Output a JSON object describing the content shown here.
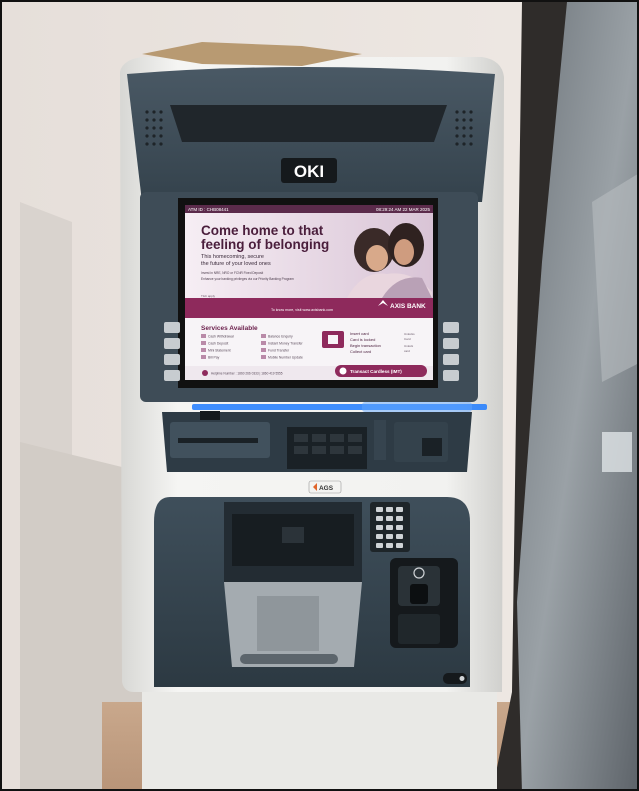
{
  "brand": {
    "label": "OKI"
  },
  "screen": {
    "status_left": "ATM ID : CHB08441",
    "status_right": "08:29:24 AM   22 MAR 2025",
    "headline_line1": "Come home to that",
    "headline_line2": "feeling of belonging",
    "subline1": "This homecoming, secure",
    "subline2": "the future of your loved ones",
    "bullet1": "Invest in NRE, NRO or FCNR Fixed Deposit",
    "bullet2": "Enhance your banking privileges via our Priority Banking Program",
    "bank_name": "AXIS BANK",
    "footer_link": "To know more, visit www.axisbank.com",
    "tc": "T&C apply",
    "services_title": "Services Available",
    "services": [
      "Cash Withdrawal",
      "Balance Enquiry",
      "Cash Deposit",
      "Instant Money Transfer",
      "Mini Statement",
      "Fund Transfer",
      "Bill Pay",
      "Mobile Number Update"
    ],
    "steps": [
      "Insert card",
      "Card is locked",
      "Begin transaction",
      "Collect card"
    ],
    "steps_side": [
      "Unlocks",
      "Card",
      "Unlock",
      "card"
    ],
    "cardless_label": "Transact Cardless (IMT)",
    "helpline": "Helpline Number : 1860 266 0333  |  1860 419 5555"
  },
  "deposit_brand": {
    "label": "AGS"
  },
  "colors": {
    "panel": "#3b4a55",
    "plum": "#8e2a5c",
    "led": "#1e7bff",
    "body": "#f1f1ef"
  }
}
